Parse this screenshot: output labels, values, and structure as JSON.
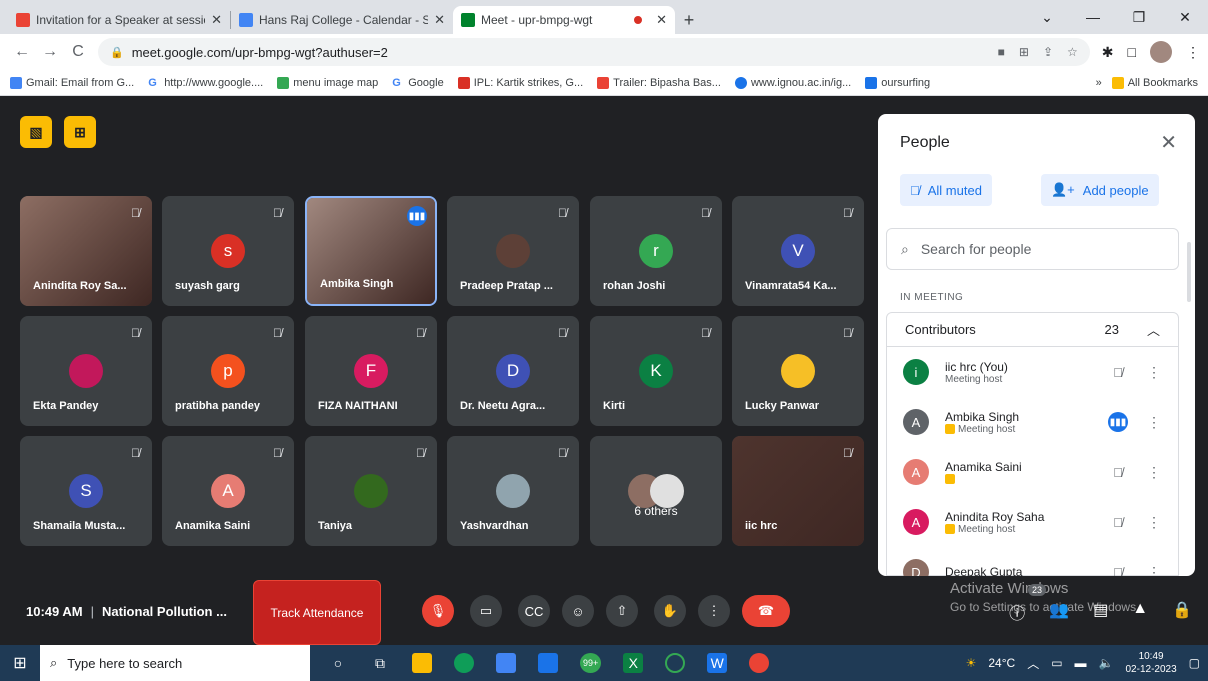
{
  "browser": {
    "tabs": [
      {
        "title": "Invitation for a Speaker at sessio",
        "favicon_color": "#ea4335"
      },
      {
        "title": "Hans Raj College - Calendar - Sa",
        "favicon_color": "#4285f4"
      },
      {
        "title": "Meet - upr-bmpg-wgt",
        "favicon_color": "#00832d"
      }
    ],
    "url": "meet.google.com/upr-bmpg-wgt?authuser=2",
    "bookmarks": [
      "Gmail: Email from G...",
      "http://www.google....",
      "menu image map",
      "Google",
      "IPL: Kartik strikes, G...",
      "Trailer: Bipasha Bas...",
      "www.ignou.ac.in/ig...",
      "oursurfing"
    ],
    "bookmarks_more": "»",
    "all_bookmarks": "All Bookmarks"
  },
  "tiles": [
    {
      "name": "Anindita Roy Sa...",
      "type": "video",
      "color": "#8d6e63"
    },
    {
      "name": "suyash garg",
      "type": "letter",
      "letter": "s",
      "color": "#d93025"
    },
    {
      "name": "Ambika Singh",
      "type": "video",
      "color": "#a1887f",
      "speaking": true
    },
    {
      "name": "Pradeep Pratap ...",
      "type": "photo",
      "color": "#5d4037"
    },
    {
      "name": "rohan Joshi",
      "type": "letter",
      "letter": "r",
      "color": "#34a853"
    },
    {
      "name": "Vinamrata54 Ka...",
      "type": "letter",
      "letter": "V",
      "color": "#3f51b5"
    },
    {
      "name": "Ekta Pandey",
      "type": "photo",
      "color": "#c2185b"
    },
    {
      "name": "pratibha pandey",
      "type": "letter",
      "letter": "p",
      "color": "#f4511e"
    },
    {
      "name": "FIZA NAITHANI",
      "type": "letter",
      "letter": "F",
      "color": "#d81b60"
    },
    {
      "name": "Dr. Neetu Agra...",
      "type": "letter",
      "letter": "D",
      "color": "#3f51b5"
    },
    {
      "name": "Kirti",
      "type": "letter",
      "letter": "K",
      "color": "#0b8043"
    },
    {
      "name": "Lucky Panwar",
      "type": "photo",
      "color": "#f6bf26"
    },
    {
      "name": "Shamaila Musta...",
      "type": "letter",
      "letter": "S",
      "color": "#3f51b5"
    },
    {
      "name": "Anamika Saini",
      "type": "letter",
      "letter": "A",
      "color": "#e67c73"
    },
    {
      "name": "Taniya",
      "type": "photo",
      "color": "#33691e"
    },
    {
      "name": "Yashvardhan",
      "type": "photo",
      "color": "#90a4ae"
    },
    {
      "name": "6 others",
      "type": "others",
      "color": "#5f6368"
    },
    {
      "name": "iic hrc",
      "type": "video",
      "color": "#4e342e"
    }
  ],
  "bottom": {
    "time": "10:49 AM",
    "meeting_title": "National Pollution ...",
    "track_attendance": "Track Attendance",
    "people_count": "23"
  },
  "watermark": {
    "line1": "Activate Windows",
    "line2": "Go to Settings to activate Windows."
  },
  "people": {
    "title": "People",
    "all_muted": "All muted",
    "add_people": "Add people",
    "search_placeholder": "Search for people",
    "in_meeting": "IN MEETING",
    "contributors_label": "Contributors",
    "contributors_count": "23",
    "list": [
      {
        "name": "iic hrc (You)",
        "role": "Meeting host",
        "letter": "i",
        "color": "#0b8043",
        "mic": "muted",
        "role_icon": false
      },
      {
        "name": "Ambika Singh",
        "role": "Meeting host",
        "letter": "A",
        "color": "#5f6368",
        "mic": "speaking",
        "role_icon": true
      },
      {
        "name": "Anamika Saini",
        "role": "",
        "letter": "A",
        "color": "#e67c73",
        "mic": "muted",
        "role_icon": true
      },
      {
        "name": "Anindita Roy Saha",
        "role": "Meeting host",
        "letter": "A",
        "color": "#d81b60",
        "mic": "muted",
        "role_icon": true
      },
      {
        "name": "Deepak Gupta",
        "role": "",
        "letter": "D",
        "color": "#8d6e63",
        "mic": "muted",
        "role_icon": false
      }
    ]
  },
  "taskbar": {
    "search_placeholder": "Type here to search",
    "mail_badge": "99+",
    "temperature": "24°C",
    "time": "10:49",
    "date": "02-12-2023"
  }
}
